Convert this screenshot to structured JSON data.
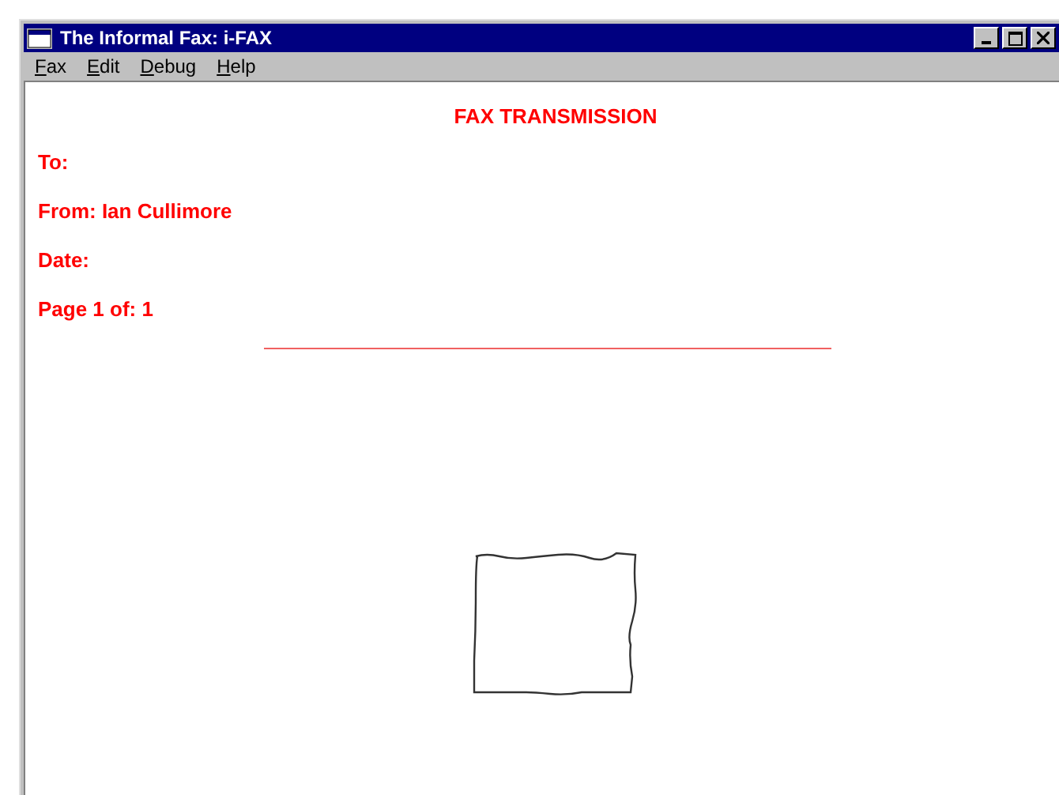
{
  "window": {
    "title": "The Informal Fax: i-FAX"
  },
  "menu": [
    {
      "label": "Fax"
    },
    {
      "label": "Edit"
    },
    {
      "label": "Debug"
    },
    {
      "label": "Help"
    }
  ],
  "document": {
    "heading": "FAX TRANSMISSION",
    "fields": [
      "To:",
      "From: Ian Cullimore",
      "Date:",
      "Page 1 of: 1"
    ]
  }
}
